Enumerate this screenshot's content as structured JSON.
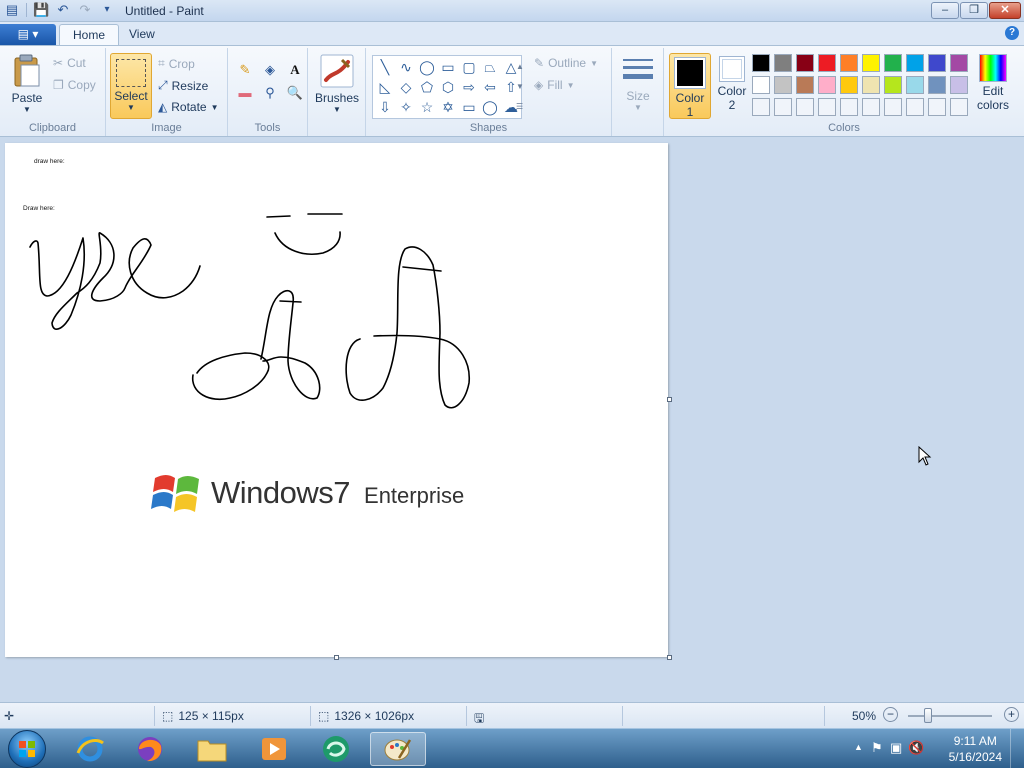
{
  "window": {
    "title": "Untitled - Paint",
    "minimize": "–",
    "maximize": "❐",
    "close": "✕"
  },
  "tabs": [
    {
      "label": "Home",
      "active": true
    },
    {
      "label": "View",
      "active": false
    }
  ],
  "ribbon": {
    "clipboard": {
      "label": "Clipboard",
      "paste": "Paste",
      "cut": "Cut",
      "copy": "Copy"
    },
    "image": {
      "label": "Image",
      "select": "Select",
      "crop": "Crop",
      "resize": "Resize",
      "rotate": "Rotate"
    },
    "tools": {
      "label": "Tools"
    },
    "brushes": {
      "label": "Brushes"
    },
    "shapes": {
      "label": "Shapes",
      "outline": "Outline",
      "fill": "Fill"
    },
    "size": {
      "label": "Size"
    },
    "colors": {
      "label": "Colors",
      "color1": "Color",
      "color1_num": "1",
      "color2": "Color",
      "color2_num": "2",
      "color1_value": "#000000",
      "color2_value": "#ffffff",
      "edit": "Edit",
      "edit2": "colors",
      "palette_row1": [
        "#000000",
        "#7f7f7f",
        "#880015",
        "#ed1c24",
        "#ff7f27",
        "#fff200",
        "#22b14c",
        "#00a2e8",
        "#3f48cc",
        "#a349a4"
      ],
      "palette_row2": [
        "#ffffff",
        "#c3c3c3",
        "#b97a57",
        "#ffaec9",
        "#ffc90e",
        "#efe4b0",
        "#b5e61d",
        "#99d9ea",
        "#7092be",
        "#c8bfe7"
      ],
      "palette_row3": [
        "#f0f4fa",
        "#f0f4fa",
        "#f0f4fa",
        "#f0f4fa",
        "#f0f4fa",
        "#f0f4fa",
        "#f0f4fa",
        "#f0f4fa",
        "#f0f4fa",
        "#f0f4fa"
      ]
    }
  },
  "canvas": {
    "text1": "draw here:",
    "text2": "Draw here:",
    "logo_word": "Windows",
    "logo_num": "7",
    "logo_edition": "Enterprise"
  },
  "status": {
    "selection_size": "125 × 115px",
    "image_size": "1326 × 1026px",
    "zoom": "50%"
  },
  "taskbar": {
    "time": "9:11 AM",
    "date": "5/16/2024"
  }
}
